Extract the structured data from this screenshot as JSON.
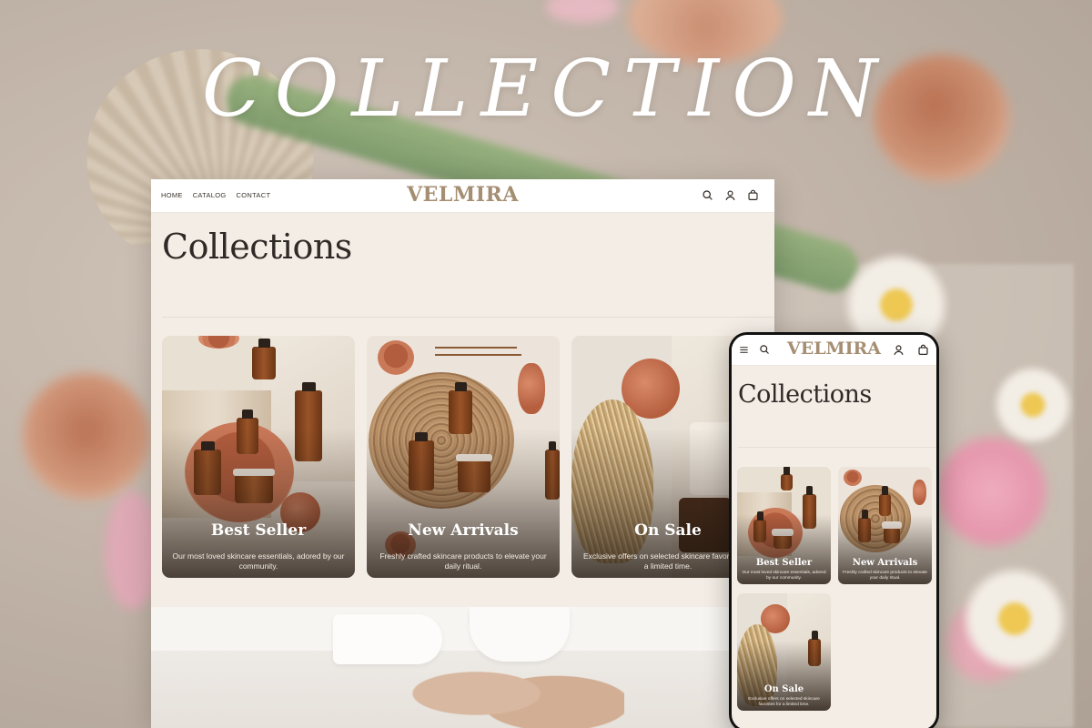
{
  "headline": "COLLECTION",
  "brand": {
    "name": "VELMIRA",
    "color": "#a58e72"
  },
  "desktop": {
    "nav": [
      "HOME",
      "CATALOG",
      "CONTACT"
    ],
    "icons": [
      "search-icon",
      "account-icon",
      "cart-icon"
    ],
    "page_title": "Collections",
    "cards": [
      {
        "title": "Best Seller",
        "description": "Our most loved skincare essentials, adored by our community."
      },
      {
        "title": "New Arrivals",
        "description": "Freshly crafted skincare products to elevate your daily ritual."
      },
      {
        "title": "On Sale",
        "description": "Exclusive offers on selected skincare favorites for a limited time."
      }
    ]
  },
  "mobile": {
    "icons": [
      "menu-icon",
      "search-icon",
      "account-icon",
      "cart-icon"
    ],
    "page_title": "Collections",
    "cards": [
      {
        "title": "Best Seller",
        "description": "Our most loved skincare essentials, adored by our community."
      },
      {
        "title": "New Arrivals",
        "description": "Freshly crafted skincare products to elevate your daily ritual."
      },
      {
        "title": "On Sale",
        "description": "Exclusive offers on selected skincare favorites for a limited time."
      }
    ]
  },
  "colors": {
    "page_bg": "#f4ede6",
    "text_dark": "#2f2a26",
    "terracotta": "#c97858",
    "amber": "#8a4a22"
  }
}
